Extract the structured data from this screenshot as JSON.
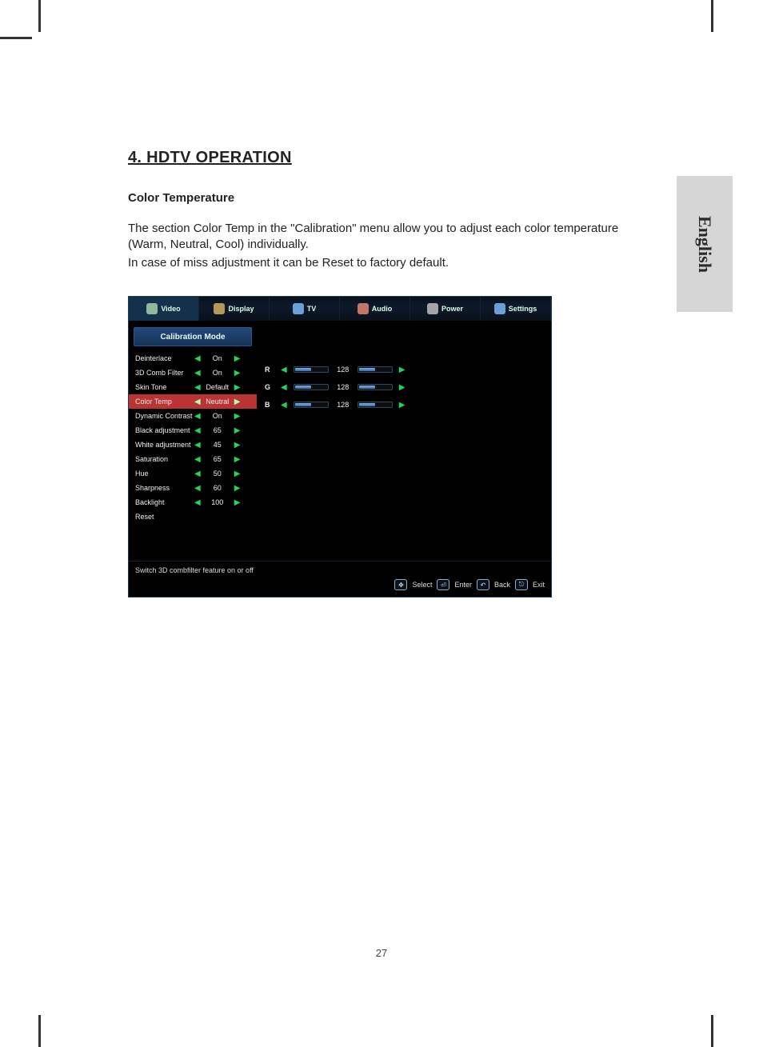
{
  "page": {
    "number": "27",
    "language_tab": "English"
  },
  "doc": {
    "heading": "4.    HDTV OPERATION",
    "subheading": "Color Temperature",
    "p1": "The section Color Temp in the \"Calibration\" menu allow you to adjust each color temperature (Warm, Neutral, Cool) individually.",
    "p2": " In case of miss adjustment it can be Reset to factory default."
  },
  "osd": {
    "tabs": [
      "Video",
      "Display",
      "TV",
      "Audio",
      "Power",
      "Settings"
    ],
    "active_tab": "Video",
    "mode_header": "Calibration Mode",
    "rows": [
      {
        "label": "Deinterlace",
        "value": "On"
      },
      {
        "label": "3D Comb Filter",
        "value": "On"
      },
      {
        "label": "Skin Tone",
        "value": "Default"
      },
      {
        "label": "Color Temp",
        "value": "Neutral",
        "selected": true
      },
      {
        "label": "Dynamic Contrast",
        "value": "On"
      },
      {
        "label": "Black adjustment",
        "value": "65"
      },
      {
        "label": "White adjustment",
        "value": "45"
      },
      {
        "label": "Saturation",
        "value": "65"
      },
      {
        "label": "Hue",
        "value": "50"
      },
      {
        "label": "Sharpness",
        "value": "60"
      },
      {
        "label": "Backlight",
        "value": "100"
      },
      {
        "label": "Reset",
        "value": "",
        "noarrows": true
      }
    ],
    "sliders": [
      {
        "ch": "R",
        "value": "128"
      },
      {
        "ch": "G",
        "value": "128"
      },
      {
        "ch": "B",
        "value": "128"
      }
    ],
    "hint": "Switch 3D combfilter feature on or off",
    "footer": [
      "Select",
      "Enter",
      "Back",
      "Exit"
    ]
  }
}
